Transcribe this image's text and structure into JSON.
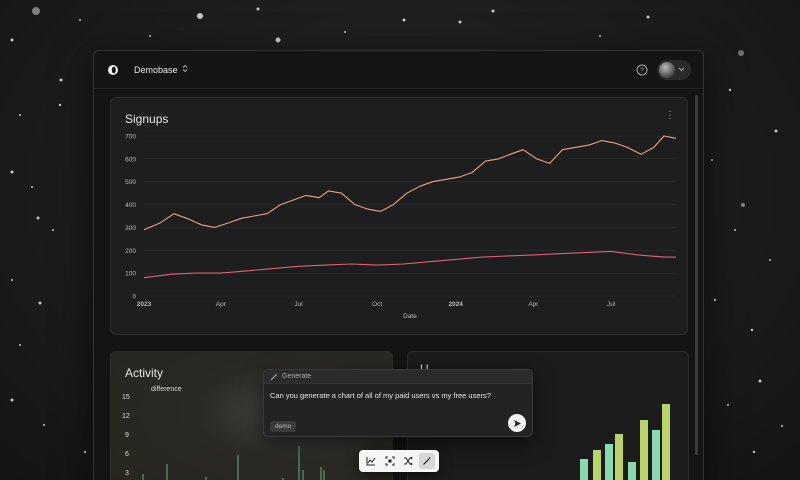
{
  "header": {
    "workspace_name": "Demobase"
  },
  "signups_card": {
    "title": "Signups",
    "menu_glyph": "⋮"
  },
  "chart_data": {
    "type": "line",
    "title": "Signups",
    "xlabel": "Date",
    "ylabel": "",
    "ylim": [
      0,
      700
    ],
    "y_ticks": [
      "0",
      "100",
      "200",
      "300",
      "400",
      "500",
      "600",
      "700"
    ],
    "x_ticks": [
      {
        "label": "2023",
        "bold": true,
        "date": "2023-01-01"
      },
      {
        "label": "Apr",
        "bold": false,
        "date": "2023-04-01"
      },
      {
        "label": "Jul",
        "bold": false,
        "date": "2023-07-01"
      },
      {
        "label": "Oct",
        "bold": false,
        "date": "2023-10-01"
      },
      {
        "label": "2024",
        "bold": true,
        "date": "2024-01-01"
      },
      {
        "label": "Apr",
        "bold": false,
        "date": "2024-04-01"
      },
      {
        "label": "Jul",
        "bold": false,
        "date": "2024-07-01"
      }
    ],
    "x_range": [
      "2023-01-01",
      "2024-09-15"
    ],
    "grid": "horizontal",
    "series": [
      {
        "color": "#f0a080",
        "points": [
          [
            "2023-01-01",
            290
          ],
          [
            "2023-01-20",
            320
          ],
          [
            "2023-02-05",
            360
          ],
          [
            "2023-02-20",
            340
          ],
          [
            "2023-03-10",
            310
          ],
          [
            "2023-03-25",
            300
          ],
          [
            "2023-04-10",
            320
          ],
          [
            "2023-04-25",
            340
          ],
          [
            "2023-05-10",
            350
          ],
          [
            "2023-05-25",
            360
          ],
          [
            "2023-06-10",
            400
          ],
          [
            "2023-06-25",
            420
          ],
          [
            "2023-07-10",
            440
          ],
          [
            "2023-07-25",
            430
          ],
          [
            "2023-08-05",
            460
          ],
          [
            "2023-08-20",
            450
          ],
          [
            "2023-09-05",
            400
          ],
          [
            "2023-09-20",
            380
          ],
          [
            "2023-10-05",
            370
          ],
          [
            "2023-10-20",
            400
          ],
          [
            "2023-11-05",
            450
          ],
          [
            "2023-11-20",
            480
          ],
          [
            "2023-12-05",
            500
          ],
          [
            "2023-12-20",
            510
          ],
          [
            "2024-01-05",
            520
          ],
          [
            "2024-01-20",
            540
          ],
          [
            "2024-02-05",
            590
          ],
          [
            "2024-02-20",
            600
          ],
          [
            "2024-03-05",
            620
          ],
          [
            "2024-03-20",
            640
          ],
          [
            "2024-04-05",
            600
          ],
          [
            "2024-04-20",
            580
          ],
          [
            "2024-05-05",
            640
          ],
          [
            "2024-05-20",
            650
          ],
          [
            "2024-06-05",
            660
          ],
          [
            "2024-06-20",
            680
          ],
          [
            "2024-07-05",
            670
          ],
          [
            "2024-07-20",
            650
          ],
          [
            "2024-08-05",
            620
          ],
          [
            "2024-08-20",
            650
          ],
          [
            "2024-09-01",
            700
          ],
          [
            "2024-09-15",
            690
          ]
        ]
      },
      {
        "color": "#e0607a",
        "points": [
          [
            "2023-01-01",
            80
          ],
          [
            "2023-02-01",
            95
          ],
          [
            "2023-03-01",
            100
          ],
          [
            "2023-04-01",
            100
          ],
          [
            "2023-05-01",
            110
          ],
          [
            "2023-06-01",
            120
          ],
          [
            "2023-07-01",
            130
          ],
          [
            "2023-08-01",
            135
          ],
          [
            "2023-09-01",
            140
          ],
          [
            "2023-10-01",
            135
          ],
          [
            "2023-11-01",
            140
          ],
          [
            "2023-12-01",
            150
          ],
          [
            "2024-01-01",
            160
          ],
          [
            "2024-02-01",
            170
          ],
          [
            "2024-03-01",
            175
          ],
          [
            "2024-04-01",
            180
          ],
          [
            "2024-05-01",
            185
          ],
          [
            "2024-06-01",
            190
          ],
          [
            "2024-07-01",
            195
          ],
          [
            "2024-08-01",
            180
          ],
          [
            "2024-09-01",
            170
          ],
          [
            "2024-09-15",
            170
          ]
        ]
      }
    ]
  },
  "activity_card": {
    "title": "Activity",
    "legend_label": "difference",
    "y_ticks": [
      "15",
      "12",
      "9",
      "6",
      "3"
    ]
  },
  "right_card": {
    "title_partial": "U"
  },
  "generate_panel": {
    "header_label": "Generate",
    "prompt": "Can you generate a chart of all of my paid users vs my free users?",
    "tag": "demo"
  },
  "toolbar": {
    "tools": [
      "line-chart",
      "scan",
      "shuffle",
      "magic-wand"
    ],
    "active": "magic-wand"
  }
}
